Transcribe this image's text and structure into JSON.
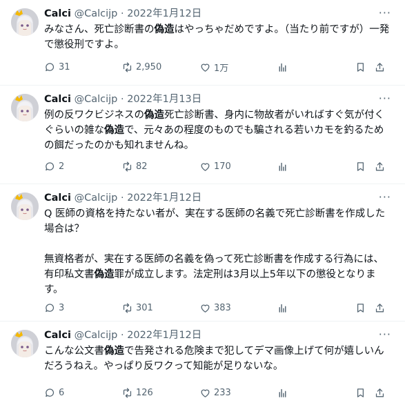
{
  "tweets": [
    {
      "author_name": "Calci",
      "handle": "@Calcijp",
      "separator": "·",
      "date": "2022年1月12日",
      "more_label": "···",
      "text_parts": [
        "みなさん、死亡診断書の",
        "偽造",
        "はやっちゃだめですよ。（当たり前ですが）一発で懲役刑ですよ。"
      ],
      "replies": "31",
      "retweets": "2,950",
      "likes": "1万"
    },
    {
      "author_name": "Calci",
      "handle": "@Calcijp",
      "separator": "·",
      "date": "2022年1月13日",
      "more_label": "···",
      "text_parts": [
        "例の反ワクビジネスの",
        "偽造",
        "死亡診断書、身内に物故者がいればすぐ気が付くぐらいの雑な",
        "偽造",
        "で、元々あの程度のものでも騙される若いカモを釣るための餌だったのかも知れませんね。"
      ],
      "replies": "2",
      "retweets": "82",
      "likes": "170"
    },
    {
      "author_name": "Calci",
      "handle": "@Calcijp",
      "separator": "·",
      "date": "2022年1月12日",
      "more_label": "···",
      "text_parts": [
        "Q 医師の資格を持たない者が、実在する医師の名義で死亡診断書を作成した場合は？\n\n無資格者が、実在する医師の名義を偽って死亡診断書を作成する行為には、有印私文書",
        "偽造",
        "罪が成立します。法定刑は3月以上5年以下の懲役となります。"
      ],
      "replies": "3",
      "retweets": "301",
      "likes": "383"
    },
    {
      "author_name": "Calci",
      "handle": "@Calcijp",
      "separator": "·",
      "date": "2022年1月12日",
      "more_label": "···",
      "text_parts": [
        "こんな公文書",
        "偽造",
        "で告発される危険まで犯してデマ画像上げて何が嬉しいんだろうねえ。やっぱり反ワクって知能が足りないな。"
      ],
      "replies": "6",
      "retweets": "126",
      "likes": "233"
    }
  ],
  "icons": {
    "reply": "speech-bubble-icon",
    "retweet": "retweet-arrows-icon",
    "like": "heart-outline-icon",
    "views": "bar-chart-icon",
    "bookmark": "bookmark-icon",
    "share": "share-upload-icon"
  },
  "colors": {
    "text": "#0f1419",
    "secondary": "#536471",
    "divider": "#eff3f4",
    "avatar_crown": "#f5b800"
  }
}
